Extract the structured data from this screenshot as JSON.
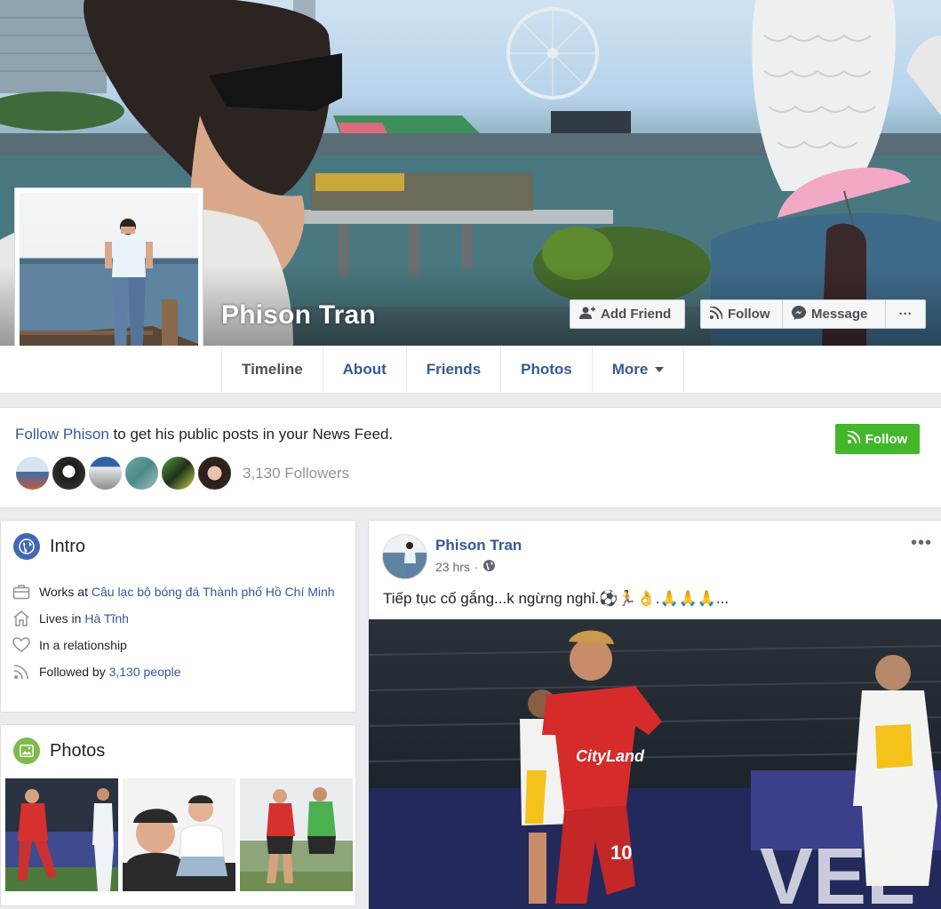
{
  "profile": {
    "name": "Phison Tran"
  },
  "cover_actions": {
    "add_friend": "Add Friend",
    "follow": "Follow",
    "message": "Message",
    "more": "···"
  },
  "nav": {
    "tabs": [
      {
        "label": "Timeline",
        "active": true
      },
      {
        "label": "About"
      },
      {
        "label": "Friends"
      },
      {
        "label": "Photos"
      },
      {
        "label": "More"
      }
    ]
  },
  "follow_banner": {
    "link_text": "Follow Phison",
    "rest_text": " to get his public posts in your News Feed.",
    "button": "Follow",
    "followers_count": "3,130 Followers"
  },
  "intro": {
    "title": "Intro",
    "works_prefix": "Works at ",
    "works_link": "Câu lạc bộ bóng đá Thành phố Hồ Chí Minh",
    "lives_prefix": "Lives in ",
    "lives_link": "Hà Tĩnh",
    "relationship": "In a relationship",
    "followed_prefix": "Followed by ",
    "followed_link": "3,130 people"
  },
  "photos": {
    "title": "Photos"
  },
  "post": {
    "author": "Phison Tran",
    "time": "23 hrs",
    "separator": "·",
    "menu": "•••",
    "text": "Tiếp tục cố gắng...k ngừng nghỉ.⚽🏃👌.🙏🙏🙏..."
  },
  "colors": {
    "link": "#365899",
    "green": "#42b72a",
    "background": "#e9ebee"
  },
  "icons": [
    "add-friend-icon",
    "rss-icon",
    "messenger-icon",
    "globe-icon",
    "briefcase-icon",
    "home-icon",
    "heart-icon",
    "photo-icon"
  ]
}
